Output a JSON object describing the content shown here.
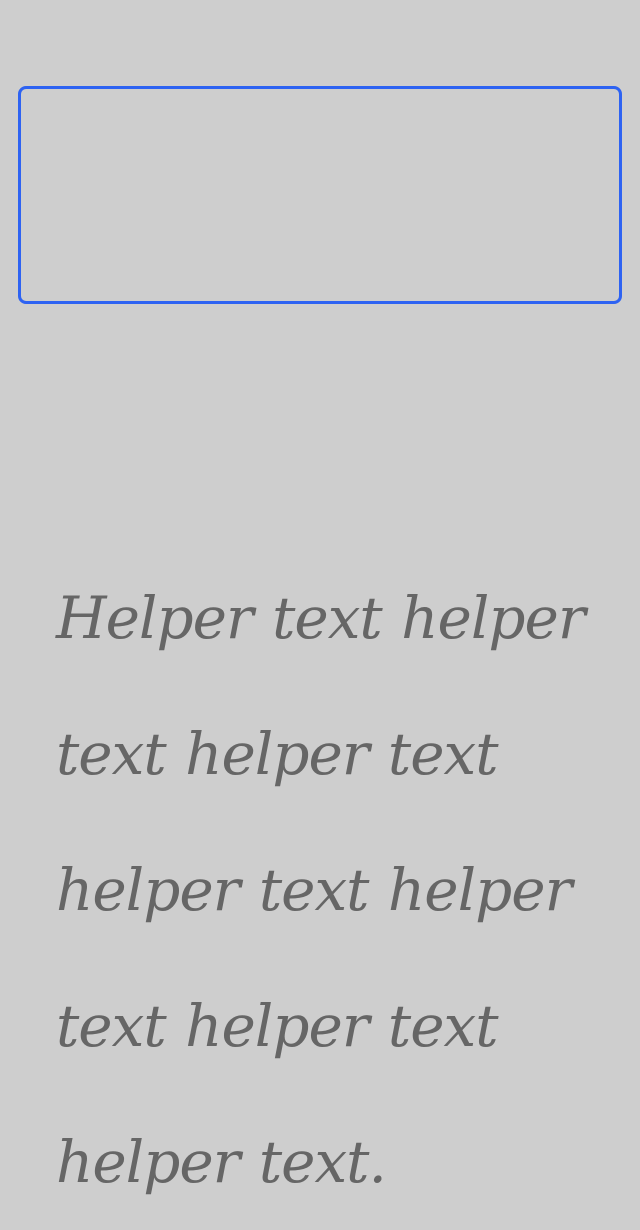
{
  "text_field": {
    "value": "",
    "placeholder": "",
    "border_color": "#2e63f2"
  },
  "helper_text": "Helper text helper text helper text helper text helper text helper text helper text.",
  "colors": {
    "background": "#cecece",
    "helper_text": "#666666"
  }
}
